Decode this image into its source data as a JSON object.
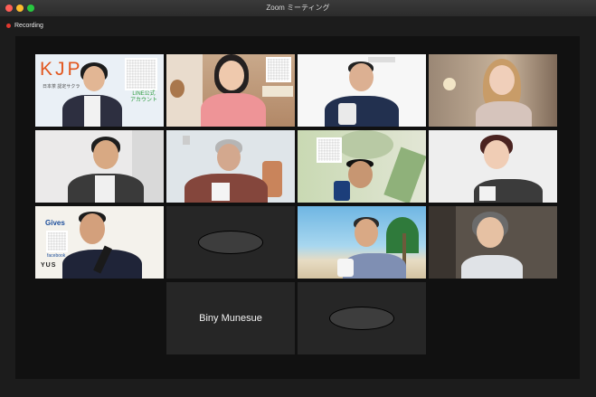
{
  "window": {
    "title": "Zoom ミーティング"
  },
  "recording": {
    "label": "Recording",
    "color": "#e0382f"
  },
  "active_speaker_color": "#39c35a",
  "tiles": [
    {
      "kjp": "KJP",
      "line": "LINE公式",
      "line2": "アカウント",
      "small": "日本茶 認定サクラ"
    },
    {},
    {},
    {},
    {},
    {},
    {},
    {},
    {
      "gives": "Gives",
      "fb": "facebook",
      "yus": "YUS"
    },
    {},
    {},
    {},
    {
      "name": "Biny Munesue"
    },
    {}
  ]
}
